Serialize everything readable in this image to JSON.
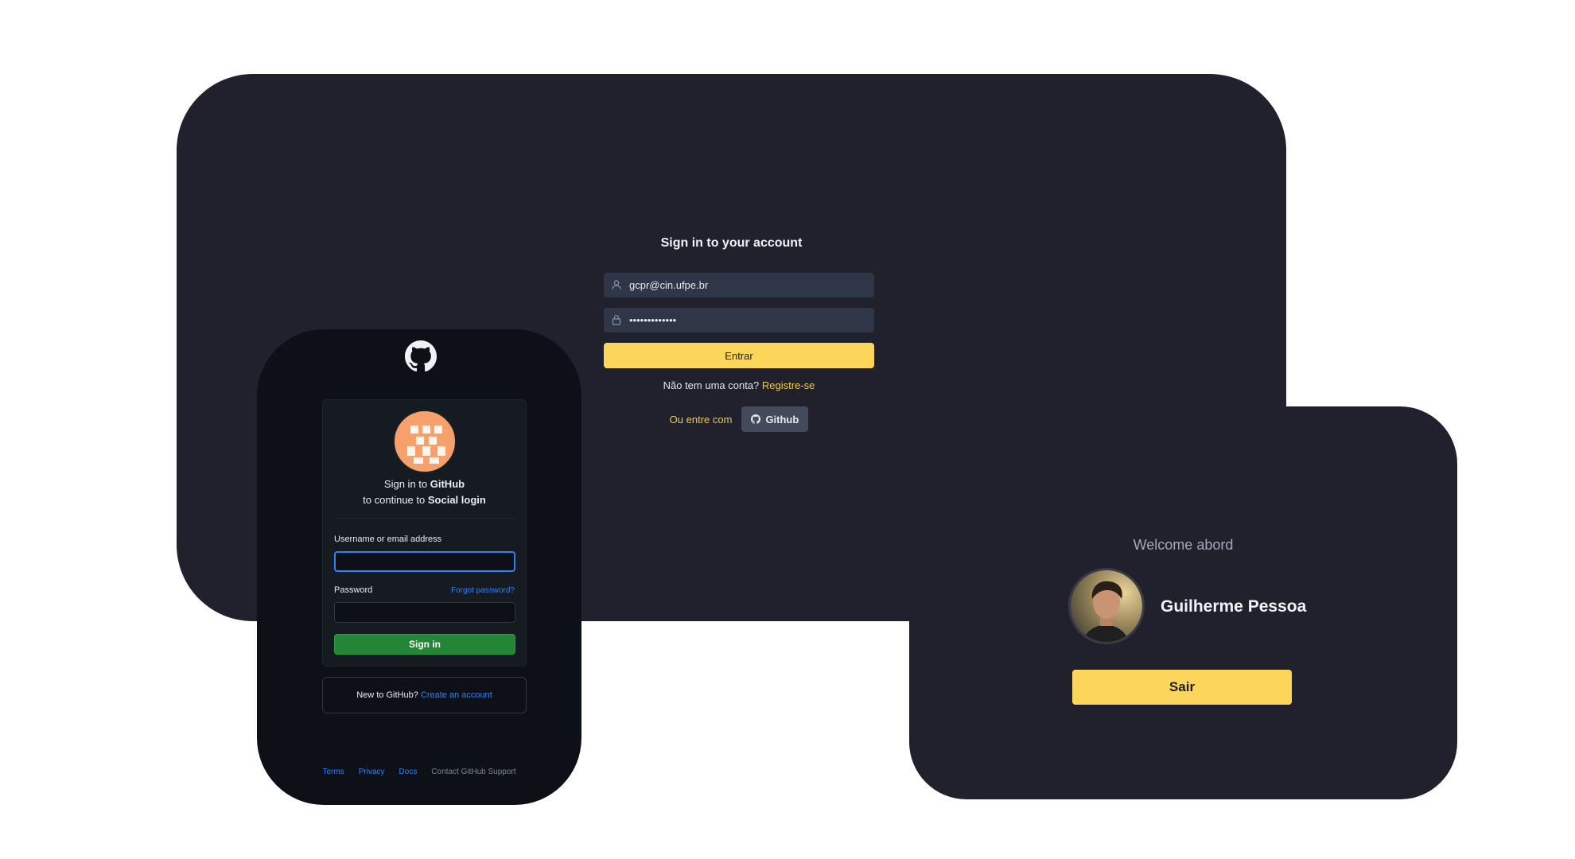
{
  "signin_panel": {
    "title": "Sign in to your account",
    "email_value": "gcpr@cin.ufpe.br",
    "password_value": "•••••••••••••",
    "submit_label": "Entrar",
    "no_account_text": "Não tem uma conta?",
    "register_link": "Registre-se",
    "alt_text": "Ou entre com",
    "github_button": "Github",
    "accent_color": "#fcd65a"
  },
  "github_panel": {
    "heading_prefix": "Sign in to",
    "heading_brand": "GitHub",
    "subheading_prefix": "to continue to",
    "subheading_app": "Social login",
    "username_label": "Username or email address",
    "password_label": "Password",
    "forgot_link": "Forgot password?",
    "signin_button": "Sign in",
    "new_text": "New to GitHub?",
    "create_link": "Create an account",
    "footer": {
      "terms": "Terms",
      "privacy": "Privacy",
      "docs": "Docs",
      "support": "Contact GitHub Support"
    },
    "icons": [
      "github-logo-icon",
      "identicon-avatar"
    ]
  },
  "welcome_panel": {
    "title": "Welcome abord",
    "user_name": "Guilherme Pessoa",
    "logout_button": "Sair"
  }
}
